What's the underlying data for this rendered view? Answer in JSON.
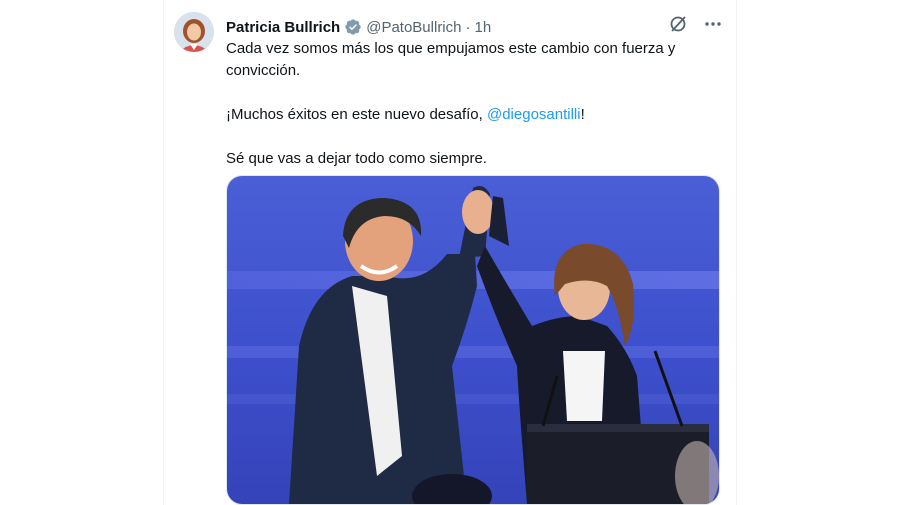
{
  "tweet": {
    "author_name": "Patricia Bullrich",
    "handle": "@PatoBullrich",
    "separator": "·",
    "time": "1h",
    "text_line1": "Cada vez somos más los que empujamos este cambio con fuerza y convicción.",
    "text_line2_prefix": "¡Muchos éxitos en este nuevo desafío, ",
    "mention": "@diegosantilli",
    "text_line2_suffix": "!",
    "text_line3": "Sé que vas a dejar todo como siempre.",
    "verified_icon": "verified-badge-icon",
    "actions_icons": [
      "grok-icon",
      "more-icon"
    ]
  },
  "colors": {
    "text": "#0f1419",
    "secondary": "#536471",
    "link": "#1d9bf0",
    "verified": "#829aab",
    "photo_bg": "#3f52c9"
  }
}
